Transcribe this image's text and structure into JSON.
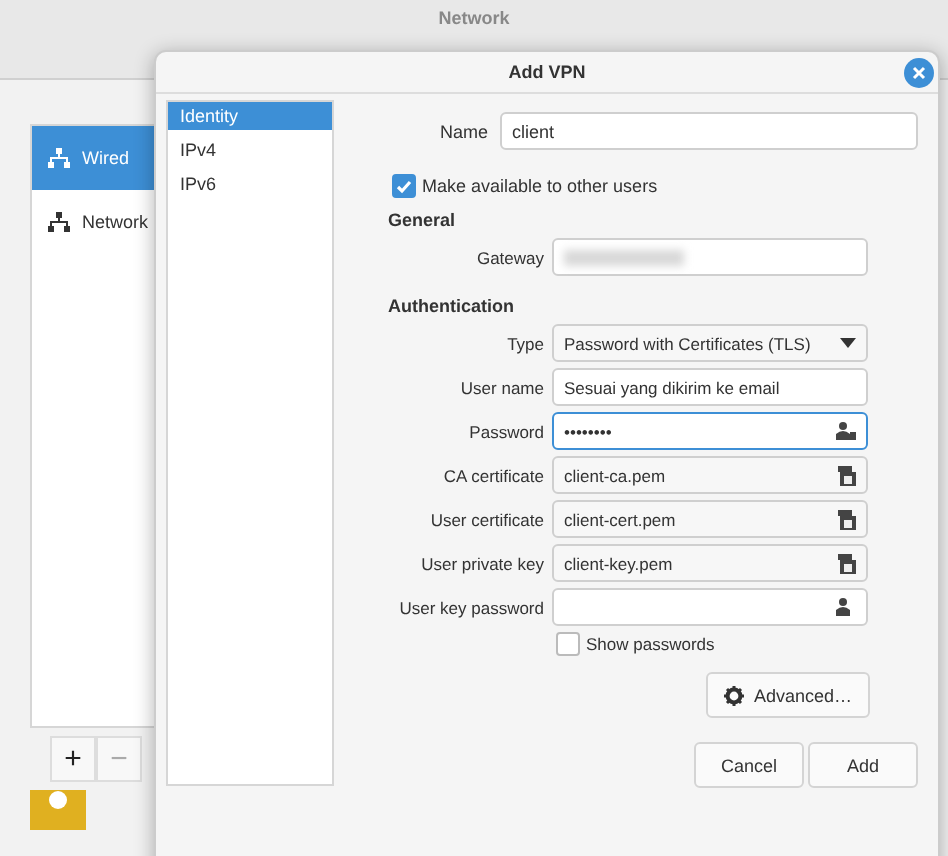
{
  "window": {
    "title": "Network"
  },
  "sidebar": {
    "items": [
      {
        "label": "Wired",
        "selected": true
      },
      {
        "label": "Network",
        "selected": false
      }
    ],
    "buttons": [
      "+",
      "−"
    ]
  },
  "dialog": {
    "title": "Add VPN",
    "tabs": [
      {
        "label": "Identity",
        "selected": true
      },
      {
        "label": "IPv4",
        "selected": false
      },
      {
        "label": "IPv6",
        "selected": false
      }
    ],
    "name": {
      "label": "Name",
      "value": "client"
    },
    "share": {
      "label": "Make available to other users",
      "checked": true
    },
    "general": {
      "heading": "General",
      "gateway": {
        "label": "Gateway",
        "blurred": true
      }
    },
    "authentication": {
      "heading": "Authentication",
      "fields": [
        {
          "kind": "dropdown",
          "label": "Type",
          "value": "Password with Certificates (TLS)",
          "focused": false
        },
        {
          "kind": "text",
          "label": "User name",
          "value": "Sesuai yang dikirim ke email",
          "focused": false
        },
        {
          "kind": "password",
          "label": "Password",
          "value": "••••••••",
          "focused": true
        },
        {
          "kind": "file",
          "label": "CA certificate",
          "value": "client-ca.pem",
          "focused": false
        },
        {
          "kind": "file",
          "label": "User certificate",
          "value": "client-cert.pem",
          "focused": false
        },
        {
          "kind": "file",
          "label": "User private key",
          "value": "client-key.pem",
          "focused": false
        },
        {
          "kind": "password",
          "label": "User key password",
          "focused": false
        }
      ]
    },
    "show_passwords": {
      "label": "Show passwords",
      "checked": false
    },
    "advanced_button": "Advanced…",
    "buttons": [
      "Cancel",
      "Add"
    ]
  }
}
